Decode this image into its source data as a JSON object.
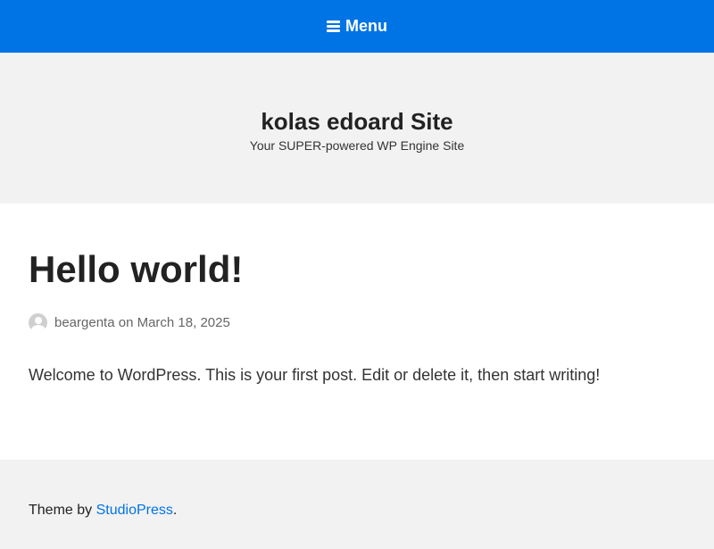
{
  "menu": {
    "label": "Menu",
    "icon": "hamburger-icon",
    "background_color": "#0073e5"
  },
  "header": {
    "site_title": "kolas edoard Site",
    "tagline": "Your SUPER-powered WP Engine Site"
  },
  "post": {
    "title": "Hello world!",
    "author": "beargenta",
    "date_prefix": "on",
    "date": "March 18, 2025",
    "content": "Welcome to WordPress. This is your first post. Edit or delete it, then start writing!"
  },
  "footer": {
    "prefix": "Theme by",
    "link_text": "StudioPress",
    "suffix": ".",
    "link_color": "#0073e5"
  }
}
